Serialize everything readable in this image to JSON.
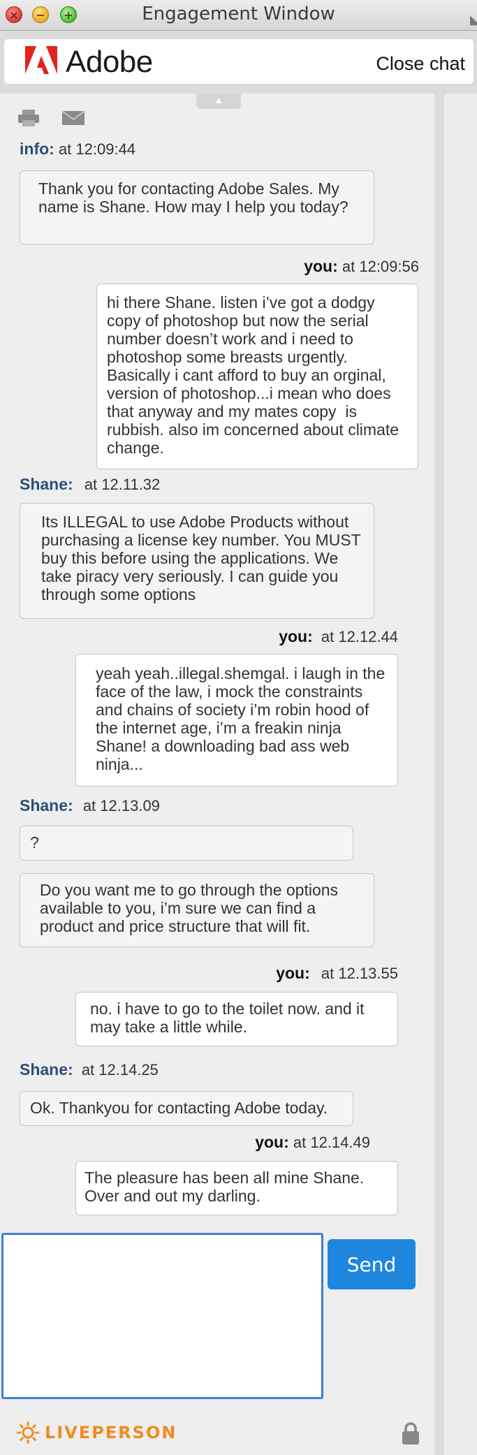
{
  "window": {
    "title": "Engagement Window"
  },
  "header": {
    "brand": "Adobe",
    "close_label": "Close chat"
  },
  "toolbar": {
    "collapse_glyph": "▲",
    "print_icon": "printer-icon",
    "email_icon": "envelope-icon"
  },
  "messages": [
    {
      "sender": "info:",
      "time": "at 12:09:44",
      "role": "agent",
      "text": "Thank you for contacting Adobe Sales. My name is Shane. How may I help you today?"
    },
    {
      "sender": "you:",
      "time": "at 12:09:56",
      "role": "user",
      "text": "hi there Shane. listen i’ve got a dodgy copy of photoshop but now the serial number doesn’t work and i need to photoshop some breasts urgently. Basically i cant afford to buy an orginal, version of photoshop...i mean who does that anyway and my mates copy  is rubbish. also im concerned about climate change."
    },
    {
      "sender": "Shane:",
      "time": "at 12.11.32",
      "role": "agent",
      "text": "Its ILLEGAL to use Adobe Products without purchasing a license key number. You MUST buy this before using the applications. We take piracy very seriously. I can guide you through some options"
    },
    {
      "sender": "you:",
      "time": "at 12.12.44",
      "role": "user",
      "text": "yeah yeah..illegal.shemgal. i laugh in the face of the law, i mock the constraints and chains of society i’m robin hood of the internet age, i’m a freakin ninja Shane! a downloading bad ass web ninja..."
    },
    {
      "sender": "Shane:",
      "time": "at 12.13.09",
      "role": "agent",
      "text": "?",
      "text2": "Do you want me to go through the options available to you, i’m sure we can find a product and price structure that will fit."
    },
    {
      "sender": "you:",
      "time": "at 12.13.55",
      "role": "user",
      "text": "no. i have to go to the toilet now. and it may take a little while."
    },
    {
      "sender": "Shane:",
      "time": "at 12.14.25",
      "role": "agent",
      "text": "Ok. Thankyou for contacting Adobe today."
    },
    {
      "sender": "you:",
      "time": "at 12.14.49",
      "role": "user",
      "text": "The pleasure has been all mine Shane. Over and out my darling."
    }
  ],
  "composer": {
    "value": "",
    "placeholder": "",
    "send_label": "Send"
  },
  "footer": {
    "brand": "LIVEPERSON",
    "lock_icon": "lock-icon"
  },
  "colors": {
    "agent_name": "#2c4f79",
    "send_button": "#1f86e0",
    "input_border": "#3d7fd6",
    "liveperson": "#f18a21",
    "adobe_red": "#e1251b"
  }
}
